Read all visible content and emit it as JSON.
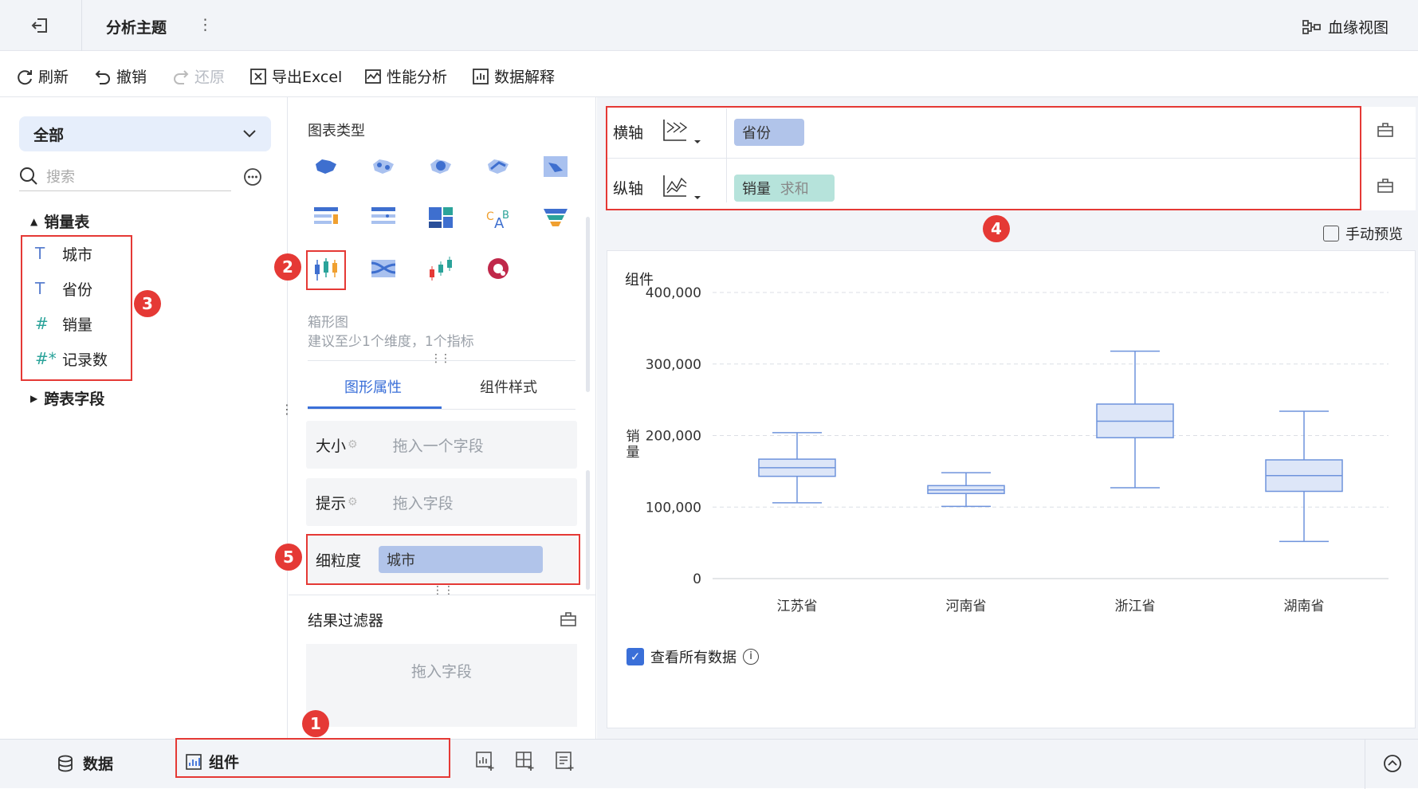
{
  "header": {
    "title": "分析主题",
    "more": "⋮",
    "lineage": "血缘视图"
  },
  "toolbar": {
    "refresh": "刷新",
    "undo": "撤销",
    "redo": "还原",
    "export": "导出Excel",
    "perf": "性能分析",
    "explain": "数据解释"
  },
  "left": {
    "scope": "全部",
    "search_placeholder": "搜索",
    "table": "销量表",
    "fields": [
      {
        "type": "T",
        "name": "城市"
      },
      {
        "type": "T",
        "name": "省份"
      },
      {
        "type": "#",
        "name": "销量"
      },
      {
        "type": "#*",
        "name": "记录数"
      }
    ],
    "cross": "跨表字段"
  },
  "mid": {
    "chart_type_title": "图表类型",
    "chart_name": "箱形图",
    "chart_hint": "建议至少1个维度，1个指标",
    "tabs": [
      "图形属性",
      "组件样式"
    ],
    "size_label": "大小",
    "size_placeholder": "拖入一个字段",
    "tip_label": "提示",
    "tip_placeholder": "拖入字段",
    "granularity_label": "细粒度",
    "granularity_value": "城市",
    "filter_title": "结果过滤器",
    "filter_placeholder": "拖入字段"
  },
  "axes": {
    "x_label": "横轴",
    "x_field": "省份",
    "y_label": "纵轴",
    "y_field": "销量",
    "y_agg": "求和",
    "manual_preview": "手动预览"
  },
  "widget": {
    "title": "组件",
    "view_all": "查看所有数据"
  },
  "bottom": {
    "data_tab": "数据",
    "widget_tab": "组件"
  },
  "badges": [
    "1",
    "2",
    "3",
    "4",
    "5"
  ],
  "colors": {
    "accent": "#3a6fd8",
    "box_fill": "#dde6f8",
    "box_stroke": "#6e93dc",
    "red": "#e53935"
  },
  "chart_data": {
    "type": "box",
    "title": "",
    "xlabel": "",
    "ylabel": "销量",
    "ylim": [
      0,
      400000
    ],
    "yticks": [
      "400,000",
      "300,000",
      "200,000",
      "100,000",
      "0"
    ],
    "categories": [
      "江苏省",
      "河南省",
      "浙江省",
      "湖南省"
    ],
    "boxes": [
      {
        "min": 106000,
        "q1": 143000,
        "median": 155000,
        "q3": 167000,
        "max": 204000
      },
      {
        "min": 101000,
        "q1": 119000,
        "median": 124000,
        "q3": 130000,
        "max": 148000
      },
      {
        "min": 127000,
        "q1": 197000,
        "median": 220000,
        "q3": 244000,
        "max": 318000
      },
      {
        "min": 52000,
        "q1": 122000,
        "median": 144000,
        "q3": 166000,
        "max": 234000
      }
    ]
  }
}
